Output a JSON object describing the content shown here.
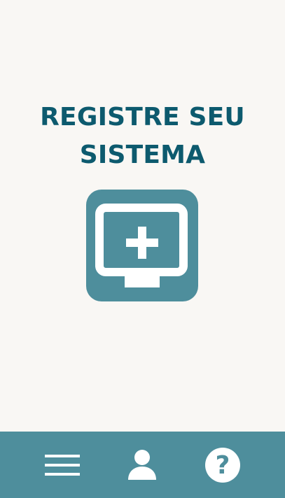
{
  "screen": {
    "title_line1": "REGISTRE SEU",
    "title_line2": "SISTEMA",
    "register_tile_icon": "monitor-plus-icon"
  },
  "bottom_nav": {
    "items": [
      {
        "icon": "hamburger-menu-icon"
      },
      {
        "icon": "user-icon"
      },
      {
        "icon": "help-icon",
        "glyph": "?"
      }
    ]
  },
  "colors": {
    "background": "#f9f7f4",
    "title": "#0d5a6e",
    "accent": "#4e8e9c",
    "icon": "#ffffff"
  }
}
